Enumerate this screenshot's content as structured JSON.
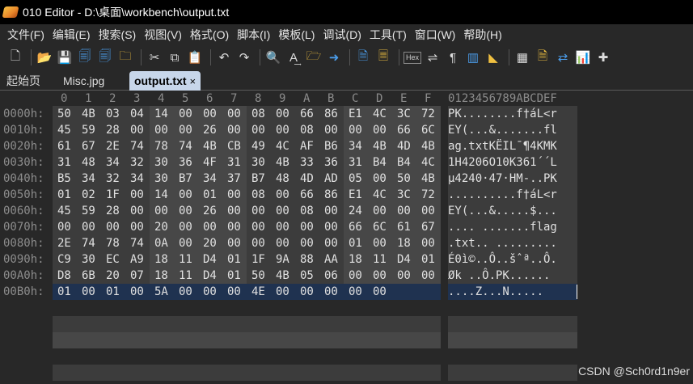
{
  "window": {
    "title": "010 Editor - D:\\桌面\\workbench\\output.txt"
  },
  "menu": [
    "文件(F)",
    "编辑(E)",
    "搜索(S)",
    "视图(V)",
    "格式(O)",
    "脚本(I)",
    "模板(L)",
    "调试(D)",
    "工具(T)",
    "窗口(W)",
    "帮助(H)"
  ],
  "toolbar": {
    "buttons": [
      {
        "name": "new-file-icon",
        "glyph": "🗋"
      },
      {
        "name": "open-folder-icon",
        "glyph": "📂"
      },
      {
        "name": "save-icon",
        "glyph": "💾"
      },
      {
        "name": "save-as-icon",
        "glyph": "🗐"
      },
      {
        "name": "save-all-icon",
        "glyph": "🗐"
      },
      {
        "name": "close-file-icon",
        "glyph": "🗀"
      },
      {
        "name": "cut-icon",
        "glyph": "✂"
      },
      {
        "name": "copy-icon",
        "glyph": "⧉"
      },
      {
        "name": "paste-icon",
        "glyph": "📋"
      },
      {
        "name": "undo-icon",
        "glyph": "↶"
      },
      {
        "name": "redo-icon",
        "glyph": "↷"
      },
      {
        "name": "find-icon",
        "glyph": "🔍"
      },
      {
        "name": "replace-icon",
        "glyph": "A͢"
      },
      {
        "name": "find-in-files-icon",
        "glyph": "🗁"
      },
      {
        "name": "goto-icon",
        "glyph": "➜"
      },
      {
        "name": "template-icon",
        "glyph": "🗎"
      },
      {
        "name": "script-icon",
        "glyph": "🗏"
      },
      {
        "name": "hex-mode-icon",
        "glyph": "Hex"
      },
      {
        "name": "text-wrap-icon",
        "glyph": "⇌"
      },
      {
        "name": "paragraph-icon",
        "glyph": "¶"
      },
      {
        "name": "columns-icon",
        "glyph": "▥"
      },
      {
        "name": "highlight-icon",
        "glyph": "◣"
      },
      {
        "name": "calculator-icon",
        "glyph": "▦"
      },
      {
        "name": "inspector-icon",
        "glyph": "🗎"
      },
      {
        "name": "compare-icon",
        "glyph": "⇄"
      },
      {
        "name": "histogram-icon",
        "glyph": "📊"
      },
      {
        "name": "tools-icon",
        "glyph": "✚"
      }
    ]
  },
  "tabs": [
    {
      "label": "起始页",
      "active": false
    },
    {
      "label": "Misc.jpg",
      "active": false
    },
    {
      "label": "output.txt",
      "active": true,
      "close": "×"
    }
  ],
  "hex": {
    "column_headers": [
      "0",
      "1",
      "2",
      "3",
      "4",
      "5",
      "6",
      "7",
      "8",
      "9",
      "A",
      "B",
      "C",
      "D",
      "E",
      "F"
    ],
    "text_header": "0123456789ABCDEF",
    "rows": [
      {
        "addr": "0000h:",
        "bytes": [
          "50",
          "4B",
          "03",
          "04",
          "14",
          "00",
          "00",
          "00",
          "08",
          "00",
          "66",
          "86",
          "E1",
          "4C",
          "3C",
          "72"
        ],
        "text": "PK........f†áL<r"
      },
      {
        "addr": "0010h:",
        "bytes": [
          "45",
          "59",
          "28",
          "00",
          "00",
          "00",
          "26",
          "00",
          "00",
          "00",
          "08",
          "00",
          "00",
          "00",
          "66",
          "6C"
        ],
        "text": "EY(...&.......fl"
      },
      {
        "addr": "0020h:",
        "bytes": [
          "61",
          "67",
          "2E",
          "74",
          "78",
          "74",
          "4B",
          "CB",
          "49",
          "4C",
          "AF",
          "B6",
          "34",
          "4B",
          "4D",
          "4B"
        ],
        "text": "ag.txtKËIL¯¶4KMK"
      },
      {
        "addr": "0030h:",
        "bytes": [
          "31",
          "48",
          "34",
          "32",
          "30",
          "36",
          "4F",
          "31",
          "30",
          "4B",
          "33",
          "36",
          "31",
          "B4",
          "B4",
          "4C"
        ],
        "text": "1H4206O10K361´´L"
      },
      {
        "addr": "0040h:",
        "bytes": [
          "B5",
          "34",
          "32",
          "34",
          "30",
          "B7",
          "34",
          "37",
          "B7",
          "48",
          "4D",
          "AD",
          "05",
          "00",
          "50",
          "4B"
        ],
        "text": "µ4240·47·HM-..PK"
      },
      {
        "addr": "0050h:",
        "bytes": [
          "01",
          "02",
          "1F",
          "00",
          "14",
          "00",
          "01",
          "00",
          "08",
          "00",
          "66",
          "86",
          "E1",
          "4C",
          "3C",
          "72"
        ],
        "text": "..........f†áL<r"
      },
      {
        "addr": "0060h:",
        "bytes": [
          "45",
          "59",
          "28",
          "00",
          "00",
          "00",
          "26",
          "00",
          "00",
          "00",
          "08",
          "00",
          "24",
          "00",
          "00",
          "00"
        ],
        "text": "EY(...&.....$..."
      },
      {
        "addr": "0070h:",
        "bytes": [
          "00",
          "00",
          "00",
          "00",
          "20",
          "00",
          "00",
          "00",
          "00",
          "00",
          "00",
          "00",
          "66",
          "6C",
          "61",
          "67"
        ],
        "text": ".... .......flag"
      },
      {
        "addr": "0080h:",
        "bytes": [
          "2E",
          "74",
          "78",
          "74",
          "0A",
          "00",
          "20",
          "00",
          "00",
          "00",
          "00",
          "00",
          "01",
          "00",
          "18",
          "00"
        ],
        "text": ".txt.. ........."
      },
      {
        "addr": "0090h:",
        "bytes": [
          "C9",
          "30",
          "EC",
          "A9",
          "18",
          "11",
          "D4",
          "01",
          "1F",
          "9A",
          "88",
          "AA",
          "18",
          "11",
          "D4",
          "01"
        ],
        "text": "É0ì©..Ô..šˆª..Ô."
      },
      {
        "addr": "00A0h:",
        "bytes": [
          "D8",
          "6B",
          "20",
          "07",
          "18",
          "11",
          "D4",
          "01",
          "50",
          "4B",
          "05",
          "06",
          "00",
          "00",
          "00",
          "00"
        ],
        "text": "Øk ..Ô.PK......"
      },
      {
        "addr": "00B0h:",
        "bytes": [
          "01",
          "00",
          "01",
          "00",
          "5A",
          "00",
          "00",
          "00",
          "4E",
          "00",
          "00",
          "00",
          "00",
          "00"
        ],
        "text": "....Z...N....."
      }
    ]
  },
  "watermark": "CSDN @Sch0rd1n9er"
}
